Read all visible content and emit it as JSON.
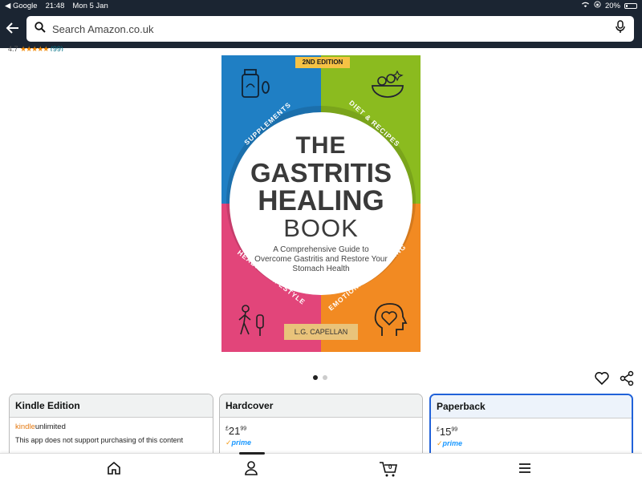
{
  "status_bar": {
    "back_app": "◀ Google",
    "time": "21:48",
    "date": "Mon 5 Jan",
    "battery": "20%",
    "battery_level": 0.2
  },
  "search": {
    "placeholder": "Search Amazon.co.uk"
  },
  "rating": {
    "value": "4.7",
    "stars": "★★★★★",
    "count": "(99)"
  },
  "cover": {
    "edition": "2ND EDITION",
    "title_lines": [
      "THE",
      "GASTRITIS",
      "HEALING",
      "BOOK"
    ],
    "subtitle": "A Comprehensive Guide to Overcome Gastritis and Restore Your Stomach Health",
    "author": "L.G. CAPELLAN",
    "segments": [
      "SUPPLEMENTS",
      "DIET & RECIPES",
      "HEALTHY LIFESTYLE",
      "EMOTIONAL WELLBEING"
    ],
    "colors": {
      "blue": "#1f7fc4",
      "green": "#8bbb1f",
      "pink": "#e2457a",
      "orange": "#f28a22"
    }
  },
  "carousel": {
    "pages": 2,
    "active": 1
  },
  "formats": [
    {
      "title": "Kindle Edition",
      "brand_kindle": "kindle",
      "brand_unlimited": "unlimited",
      "note": "This app does not support purchasing of this content",
      "selected": false
    },
    {
      "title": "Hardcover",
      "currency": "£",
      "price_main": "21",
      "price_fraction": "99",
      "prime": "prime",
      "selected": false
    },
    {
      "title": "Paperback",
      "currency": "£",
      "price_main": "15",
      "price_fraction": "99",
      "prime": "prime",
      "selected": true
    }
  ],
  "bottom_nav": {
    "items": [
      "home-icon",
      "account-icon",
      "cart-icon",
      "menu-icon"
    ],
    "cart_count": "0",
    "active": "account-icon"
  },
  "accent_color": "#2162d9",
  "header_color": "#1b2532"
}
